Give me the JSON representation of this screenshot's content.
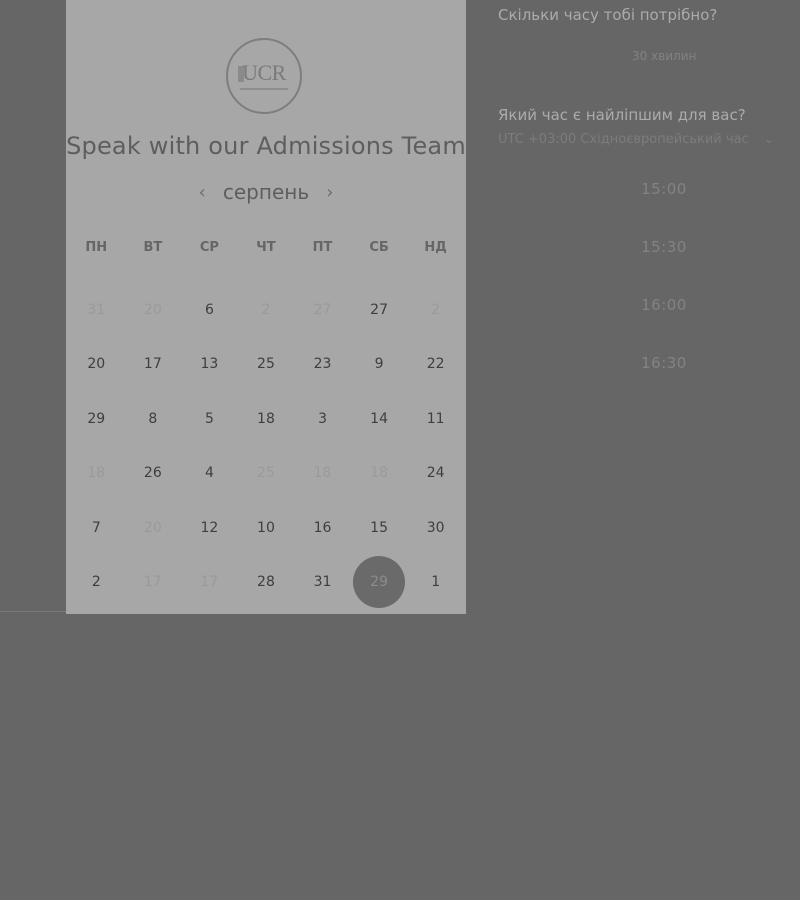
{
  "calendar": {
    "logo_text": "UCR",
    "title": "Speak with our Admissions Team",
    "month": "серпень",
    "prev_arrow": "‹",
    "next_arrow": "›",
    "weekdays": [
      "ПН",
      "ВТ",
      "СР",
      "ЧТ",
      "ПТ",
      "СБ",
      "НД"
    ],
    "days": [
      {
        "label": "31",
        "muted": true
      },
      {
        "label": "20",
        "muted": true
      },
      {
        "label": "6",
        "muted": false
      },
      {
        "label": "2",
        "muted": true
      },
      {
        "label": "27",
        "muted": true
      },
      {
        "label": "27",
        "muted": false
      },
      {
        "label": "2",
        "muted": true
      },
      {
        "label": "20",
        "muted": false
      },
      {
        "label": "17",
        "muted": false
      },
      {
        "label": "13",
        "muted": false
      },
      {
        "label": "25",
        "muted": false
      },
      {
        "label": "23",
        "muted": false
      },
      {
        "label": "9",
        "muted": false
      },
      {
        "label": "22",
        "muted": false
      },
      {
        "label": "29",
        "muted": false
      },
      {
        "label": "8",
        "muted": false
      },
      {
        "label": "5",
        "muted": false
      },
      {
        "label": "18",
        "muted": false
      },
      {
        "label": "3",
        "muted": false
      },
      {
        "label": "14",
        "muted": false
      },
      {
        "label": "11",
        "muted": false
      },
      {
        "label": "18",
        "muted": true
      },
      {
        "label": "26",
        "muted": false
      },
      {
        "label": "4",
        "muted": false
      },
      {
        "label": "25",
        "muted": true
      },
      {
        "label": "18",
        "muted": true
      },
      {
        "label": "18",
        "muted": true
      },
      {
        "label": "24",
        "muted": false
      },
      {
        "label": "7",
        "muted": false
      },
      {
        "label": "20",
        "muted": true
      },
      {
        "label": "12",
        "muted": false
      },
      {
        "label": "10",
        "muted": false
      },
      {
        "label": "16",
        "muted": false
      },
      {
        "label": "15",
        "muted": false
      },
      {
        "label": "30",
        "muted": false
      },
      {
        "label": "2",
        "muted": false
      },
      {
        "label": "17",
        "muted": true
      },
      {
        "label": "17",
        "muted": true
      },
      {
        "label": "28",
        "muted": false
      },
      {
        "label": "31",
        "muted": false
      },
      {
        "label": "29",
        "muted": false,
        "selected": true
      },
      {
        "label": "1",
        "muted": false
      }
    ]
  },
  "booking": {
    "duration_question": "Скільки часу тобі потрібно?",
    "duration_value": "30 хвилин",
    "time_question": "Який час є найліпшим для вас?",
    "timezone": "UTC +03:00 Східноєвропейський час",
    "timezone_chevron": "⌄",
    "slots": [
      "15:00",
      "15:30",
      "16:00",
      "16:30"
    ]
  },
  "colors": {
    "background": "#666666",
    "card": "#a7a7a7",
    "selected_day": "#6a6a6a"
  }
}
